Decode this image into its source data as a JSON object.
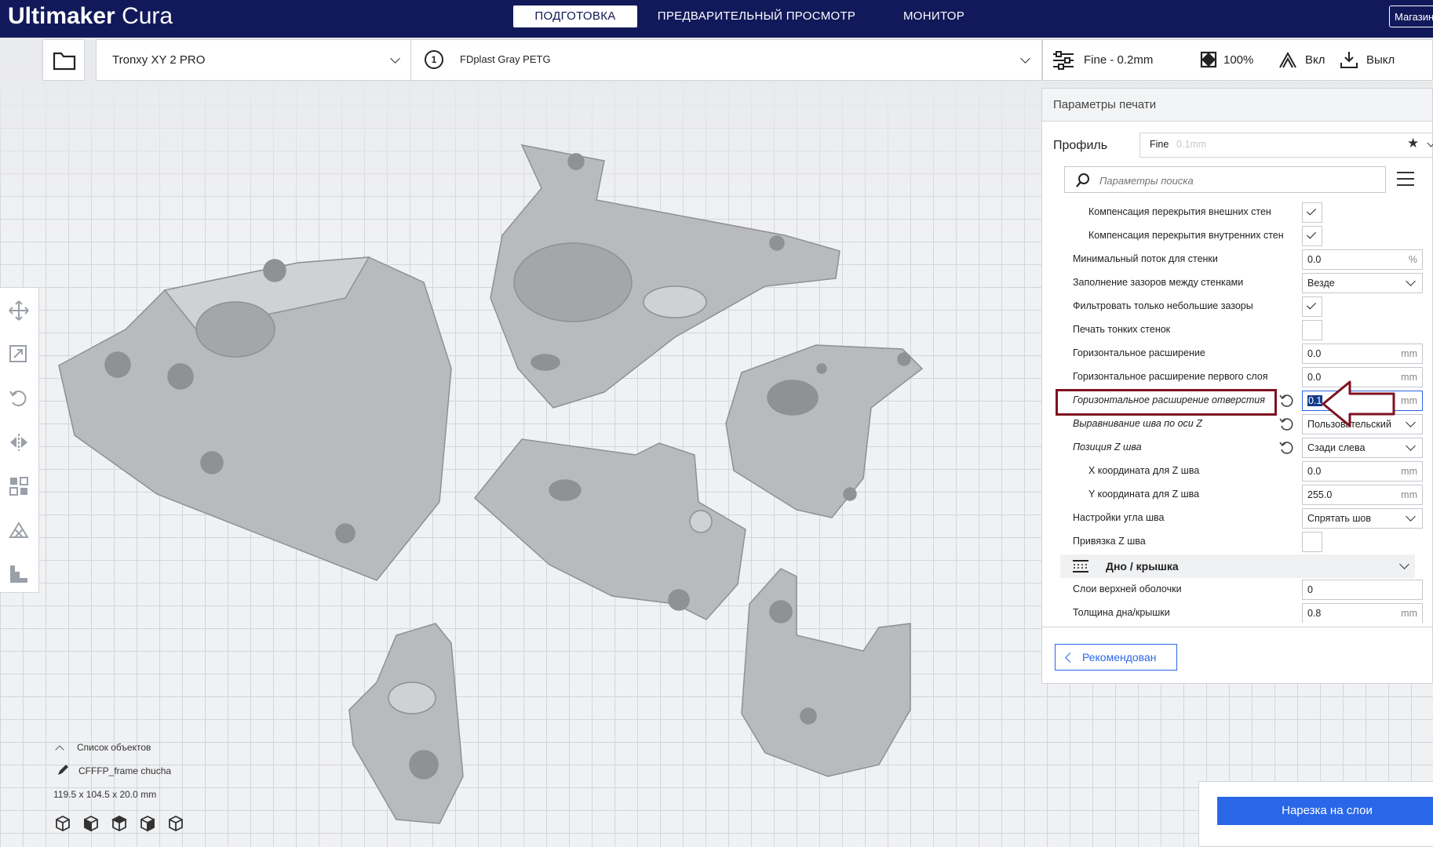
{
  "app": {
    "brand_bold": "Ultimaker",
    "brand_light": " Cura"
  },
  "header": {
    "tabs": [
      {
        "label": "ПОДГОТОВКА",
        "active": true
      },
      {
        "label": "ПРЕДВАРИТЕЛЬНЫЙ ПРОСМОТР",
        "active": false
      },
      {
        "label": "МОНИТОР",
        "active": false
      }
    ],
    "store_label": "Магазин"
  },
  "toolbar": {
    "printer": "Tronxy XY 2 PRO",
    "extruder_number": "1",
    "material": "FDplast Gray PETG",
    "profile_summary": "Fine - 0.2mm",
    "infill": "100%",
    "support": "Вкл",
    "adhesion": "Выкл"
  },
  "print_settings": {
    "title": "Параметры печати",
    "profile_label": "Профиль",
    "profile_value": "Fine",
    "profile_layer": "0.1mm",
    "search_placeholder": "Параметры поиска",
    "rows": [
      {
        "label": "Компенсация перекрытия внешних стен",
        "type": "checkbox",
        "checked": true
      },
      {
        "label": "Компенсация перекрытия внутренних стен",
        "type": "checkbox",
        "checked": true
      },
      {
        "label": "Минимальный поток для стенки",
        "type": "number",
        "value": "0.0",
        "unit": "%"
      },
      {
        "label": "Заполнение зазоров между стенками",
        "type": "select",
        "value": "Везде"
      },
      {
        "label": "Фильтровать только небольшие зазоры",
        "type": "checkbox",
        "checked": true
      },
      {
        "label": "Печать тонких стенок",
        "type": "checkbox",
        "checked": false
      },
      {
        "label": "Горизонтальное расширение",
        "type": "number",
        "value": "0.0",
        "unit": "mm"
      },
      {
        "label": "Горизонтальное расширение первого слоя",
        "type": "number",
        "value": "0.0",
        "unit": "mm"
      },
      {
        "label": "Горизонтальное расширение отверстия",
        "type": "number",
        "value": "0.1",
        "unit": "mm",
        "modified": true,
        "focused": true
      },
      {
        "label": "Выравнивание шва по оси Z",
        "type": "select",
        "value": "Пользовательский",
        "modified": true
      },
      {
        "label": "Позиция Z шва",
        "type": "select",
        "value": "Сзади слева",
        "modified": true
      },
      {
        "label": "X координата для Z шва",
        "type": "number",
        "value": "0.0",
        "unit": "mm"
      },
      {
        "label": "Y координата для Z шва",
        "type": "number",
        "value": "255.0",
        "unit": "mm"
      },
      {
        "label": "Настройки угла шва",
        "type": "select",
        "value": "Спрятать шов"
      },
      {
        "label": "Привязка Z шва",
        "type": "checkbox",
        "checked": false
      },
      {
        "label": "Дно / крышка",
        "type": "category"
      },
      {
        "label": "Слои верхней оболочки",
        "type": "number",
        "value": "0",
        "unit": ""
      },
      {
        "label": "Толщина дна/крышки",
        "type": "number",
        "value": "0.8",
        "unit": "mm"
      }
    ],
    "recommended_label": "Рекомендован"
  },
  "object_list": {
    "header": "Список объектов",
    "object_name": "CFFFP_frame chucha",
    "dimensions": "119.5 x 104.5 x 20.0 mm"
  },
  "slice_button": "Нарезка на слои",
  "colors": {
    "header_bg": "#12195a",
    "accent": "#2a67e8",
    "highlight": "#7e1120",
    "model": "#b9bbbe"
  }
}
